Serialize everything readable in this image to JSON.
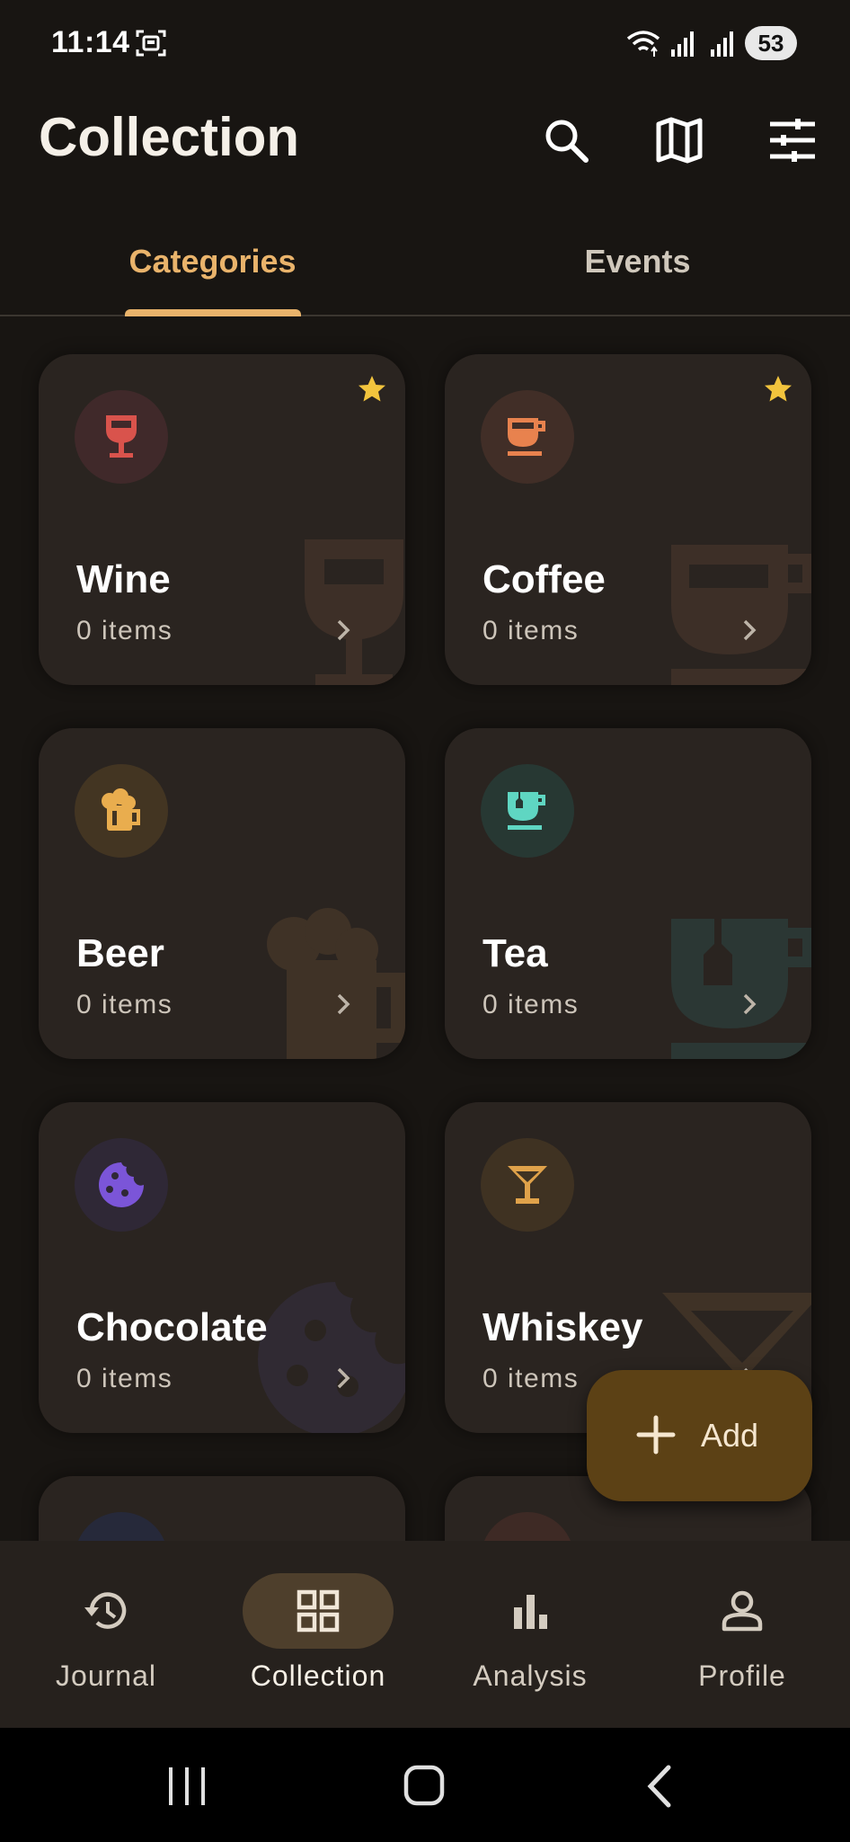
{
  "status_bar": {
    "time": "11:14",
    "battery": "53"
  },
  "app_bar": {
    "title": "Collection",
    "actions": [
      {
        "name": "search-button",
        "icon": "search-icon"
      },
      {
        "name": "map-button",
        "icon": "map-icon"
      },
      {
        "name": "filter-button",
        "icon": "tune-icon"
      }
    ]
  },
  "tabs": [
    {
      "label": "Categories",
      "active": true
    },
    {
      "label": "Events",
      "active": false
    }
  ],
  "categories": [
    {
      "title": "Wine",
      "count": "0 items",
      "icon": "wine-glass-icon",
      "color": "#d9534c",
      "favorite": true
    },
    {
      "title": "Coffee",
      "count": "0 items",
      "icon": "coffee-cup-icon",
      "color": "#e8824e",
      "favorite": true
    },
    {
      "title": "Beer",
      "count": "0 items",
      "icon": "beer-mug-icon",
      "color": "#e9ad4e",
      "favorite": false
    },
    {
      "title": "Tea",
      "count": "0 items",
      "icon": "tea-cup-icon",
      "color": "#5fd6c2",
      "favorite": false
    },
    {
      "title": "Chocolate",
      "count": "0 items",
      "icon": "cookie-icon",
      "color": "#7b55d8",
      "favorite": false
    },
    {
      "title": "Whiskey",
      "count": "0 items",
      "icon": "cocktail-glass-icon",
      "color": "#e0a24a",
      "favorite": false
    }
  ],
  "fab": {
    "label": "Add"
  },
  "bottom_nav": [
    {
      "label": "Journal",
      "icon": "history-icon",
      "active": false
    },
    {
      "label": "Collection",
      "icon": "grid-icon",
      "active": true
    },
    {
      "label": "Analysis",
      "icon": "bar-chart-icon",
      "active": false
    },
    {
      "label": "Profile",
      "icon": "person-icon",
      "active": false
    }
  ],
  "colors": {
    "background": "#181512",
    "card": "#2a2420",
    "accent": "#e9b36b",
    "favorite_star": "#f2c43d",
    "fab": "#5c4115",
    "nav_active_pill": "#4e3f2c"
  }
}
